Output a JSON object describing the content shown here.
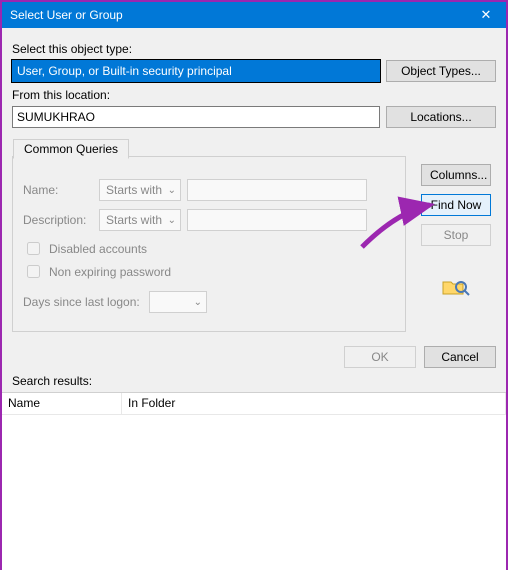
{
  "titlebar": {
    "title": "Select User or Group"
  },
  "object_type": {
    "label": "Select this object type:",
    "value": "User, Group, or Built-in security principal",
    "button": "Object Types..."
  },
  "location": {
    "label": "From this location:",
    "value": "SUMUKHRAO",
    "button": "Locations..."
  },
  "queries": {
    "tab": "Common Queries",
    "name_label": "Name:",
    "name_mode": "Starts with",
    "desc_label": "Description:",
    "desc_mode": "Starts with",
    "disabled_label": "Disabled accounts",
    "nonexpire_label": "Non expiring password",
    "days_label": "Days since last logon:"
  },
  "side": {
    "columns_btn": "Columns...",
    "find_btn": "Find Now",
    "stop_btn": "Stop"
  },
  "bottom": {
    "ok": "OK",
    "cancel": "Cancel",
    "results_label": "Search results:"
  },
  "results": {
    "col_name": "Name",
    "col_folder": "In Folder"
  }
}
